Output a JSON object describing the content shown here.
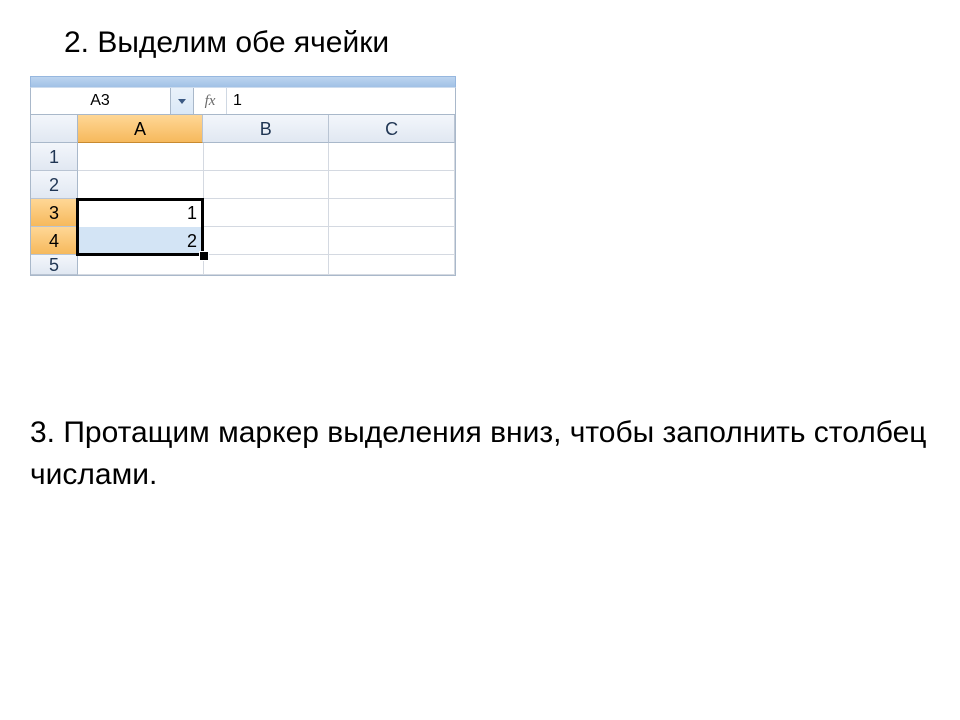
{
  "step2": "2. Выделим обе ячейки",
  "step3": "3. Протащим маркер выделения вниз, чтобы заполнить столбец числами.",
  "excel": {
    "namebox": "A3",
    "fx_label": "fx",
    "formula_value": "1",
    "columns": [
      "A",
      "B",
      "C"
    ],
    "rows": [
      "1",
      "2",
      "3",
      "4",
      "5"
    ],
    "selected_column": "A",
    "selected_rows": [
      "3",
      "4"
    ],
    "cellA3": "1",
    "cellA4": "2"
  }
}
